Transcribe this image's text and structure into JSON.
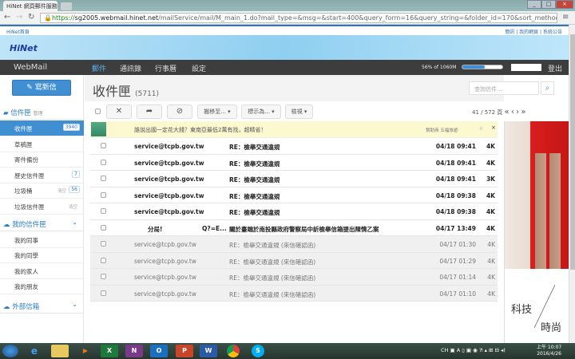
{
  "browser": {
    "tab_title": "HiNet 網頁郵件服務",
    "url_scheme": "https://",
    "url_host": "sg2005.webmail.hinet.net",
    "url_path": "/mailService/mail/M_main_1.do?mail_type=&msg=&start=400&query_form=16&query_string=&folder_id=170&sort_method=1&s"
  },
  "toplinks": {
    "left": "HiNet首頁",
    "right": "簡訊 | 我的網頁 | 系統公告"
  },
  "logo": "HiNet",
  "nav": {
    "brand": "WebMail",
    "items": [
      "郵件",
      "通訊錄",
      "行事曆",
      "設定"
    ],
    "quota": "56% of 1060M",
    "quota_percent": 56,
    "logout": "登出"
  },
  "sidebar": {
    "compose": "寫新信",
    "inbox_header": "信件匣",
    "manage": "管理",
    "folders": [
      {
        "label": "收件匣",
        "badge": "3940"
      },
      {
        "label": "草稿匣"
      },
      {
        "label": "寄件備份"
      },
      {
        "label": "歷史信件匣",
        "badge": "7"
      },
      {
        "label": "垃圾桶",
        "clear": "清空",
        "badge": "56"
      },
      {
        "label": "垃圾信件匣",
        "clear": "清空"
      }
    ],
    "my_header": "我的信件匣",
    "my_folders": [
      "我的同事",
      "我的同學",
      "我的家人",
      "我的朋友"
    ],
    "ext_header": "外部信箱"
  },
  "main": {
    "title": "收件匣",
    "count": "(5711)",
    "search_placeholder": "查詢信件...",
    "toolbar": {
      "move": "搬移至... ▾",
      "mark": "標示為... ▾",
      "view": "檢視 ▾"
    },
    "pager": "41 / 572 頁",
    "ad": {
      "text": "誰說出國一定花大錢？東南亞最低2萬有找，超精省！",
      "sponsor": "贊助商 五福旅遊"
    },
    "rows": [
      {
        "from": "service@tcpb.gov.tw",
        "subject": "RE：檢舉交通違規",
        "date": "04/18 09:41",
        "size": "4K",
        "unread": true
      },
      {
        "from": "service@tcpb.gov.tw",
        "subject": "RE：檢舉交通違規",
        "date": "04/18 09:41",
        "size": "4K",
        "unread": true
      },
      {
        "from": "service@tcpb.gov.tw",
        "subject": "RE：檢舉交通違規",
        "date": "04/18 09:41",
        "size": "3K",
        "unread": true
      },
      {
        "from": "service@tcpb.gov.tw",
        "subject": "RE：檢舉交通違規",
        "date": "04/18 09:38",
        "size": "4K",
        "unread": true
      },
      {
        "from": "service@tcpb.gov.tw",
        "subject": "RE：檢舉交通違規",
        "date": "04/18 09:38",
        "size": "4K",
        "unread": true
      },
      {
        "from": "分局!",
        "from2": "Q?=E...",
        "subject": "關於臺端於南投縣政府警察局中訢檢舉信箱提出陳情乙案",
        "date": "04/17 13:49",
        "size": "4K",
        "unread": true
      },
      {
        "from": "service@tcpb.gov.tw",
        "subject": "RE：檢舉交通違規 (來信確認函)",
        "date": "04/17 01:30",
        "size": "4K",
        "unread": false
      },
      {
        "from": "service@tcpb.gov.tw",
        "subject": "RE：檢舉交通違規 (來信確認函)",
        "date": "04/17 01:29",
        "size": "4K",
        "unread": false
      },
      {
        "from": "service@tcpb.gov.tw",
        "subject": "RE：檢舉交通違規 (來信確認函)",
        "date": "04/17 01:14",
        "size": "4K",
        "unread": false
      },
      {
        "from": "service@tcpb.gov.tw",
        "subject": "RE：檢舉交通違規 (來信確認函)",
        "date": "04/17 01:10",
        "size": "4K",
        "unread": false
      }
    ]
  },
  "side_ad": {
    "line1": "科技",
    "line2": "時尚"
  },
  "taskbar": {
    "lang": "CH",
    "time": "上午 10:07",
    "date": "2016/4/26"
  }
}
